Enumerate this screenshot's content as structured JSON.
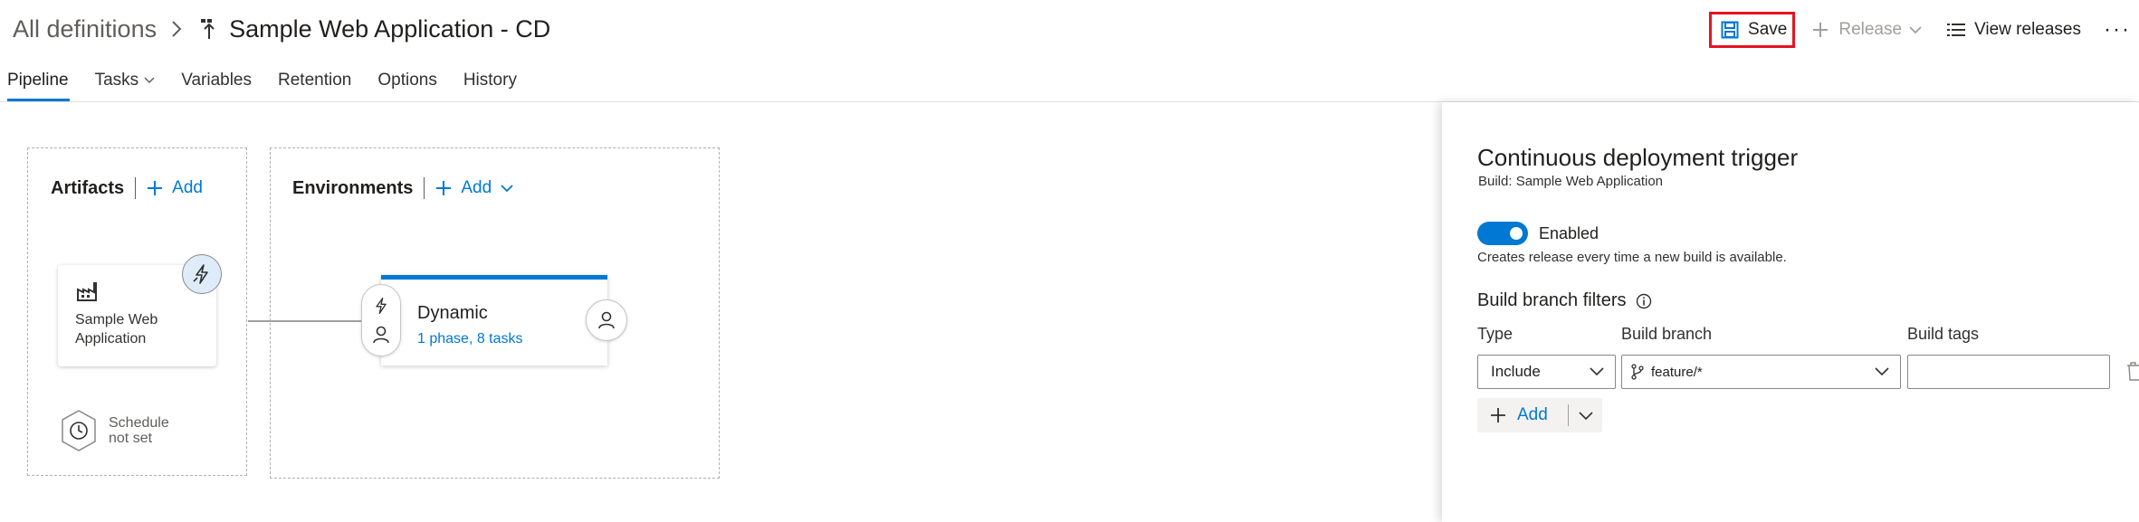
{
  "breadcrumb": {
    "root": "All definitions",
    "title": "Sample Web Application - CD"
  },
  "toolbar": {
    "save": "Save",
    "release": "Release",
    "view_releases": "View releases",
    "more": "···"
  },
  "tabs": [
    {
      "label": "Pipeline",
      "active": true
    },
    {
      "label": "Tasks",
      "has_dropdown": true
    },
    {
      "label": "Variables"
    },
    {
      "label": "Retention"
    },
    {
      "label": "Options"
    },
    {
      "label": "History"
    }
  ],
  "artifacts": {
    "heading": "Artifacts",
    "add": "Add",
    "card_name": "Sample Web Application",
    "schedule_line1": "Schedule",
    "schedule_line2": "not set"
  },
  "environments": {
    "heading": "Environments",
    "add": "Add",
    "card": {
      "name": "Dynamic",
      "summary": "1 phase, 8 tasks"
    }
  },
  "panel": {
    "title": "Continuous deployment trigger",
    "subtitle": "Build: Sample Web Application",
    "toggle_label": "Enabled",
    "toggle_on": true,
    "toggle_desc": "Creates release every time a new build is available.",
    "filters_title": "Build branch filters",
    "columns": {
      "type": "Type",
      "branch": "Build branch",
      "tags": "Build tags"
    },
    "row": {
      "type": "Include",
      "branch": "feature/*",
      "tags": ""
    },
    "add": "Add"
  },
  "colors": {
    "accent": "#0078d4",
    "highlight_border": "#e81123",
    "disabled_text": "#a19f9d"
  }
}
